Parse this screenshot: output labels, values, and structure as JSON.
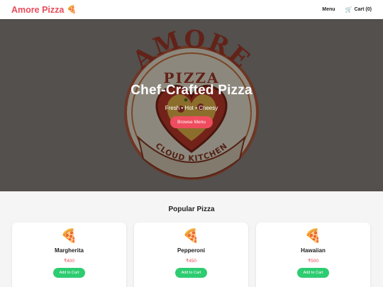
{
  "header": {
    "brand": "Amore Pizza",
    "brand_emoji": "🍕",
    "nav_menu": "Menu",
    "cart_icon": "🛒",
    "cart_label": "Cart (0)"
  },
  "hero": {
    "logo": {
      "top_word": "AMORE",
      "middle_word": "PIZZA",
      "bottom_words": "CLOUD KITCHEN"
    },
    "title": "Chef-Crafted Pizza",
    "subtitle": "Fresh • Hot • Cheesy",
    "button": "Browse Menu"
  },
  "popular": {
    "title": "Popular Pizza",
    "items": [
      {
        "emoji": "🍕",
        "name": "Margherita",
        "price": "₹400",
        "button": "Add to Cart"
      },
      {
        "emoji": "🍕",
        "name": "Pepperoni",
        "price": "₹450",
        "button": "Add to Cart"
      },
      {
        "emoji": "🍕",
        "name": "Hawaiian",
        "price": "₹500",
        "button": "Add to Cart"
      }
    ]
  },
  "colors": {
    "brand": "#e74c5b",
    "hero_button": "#ef4d5f",
    "add_button": "#2ecc71"
  }
}
